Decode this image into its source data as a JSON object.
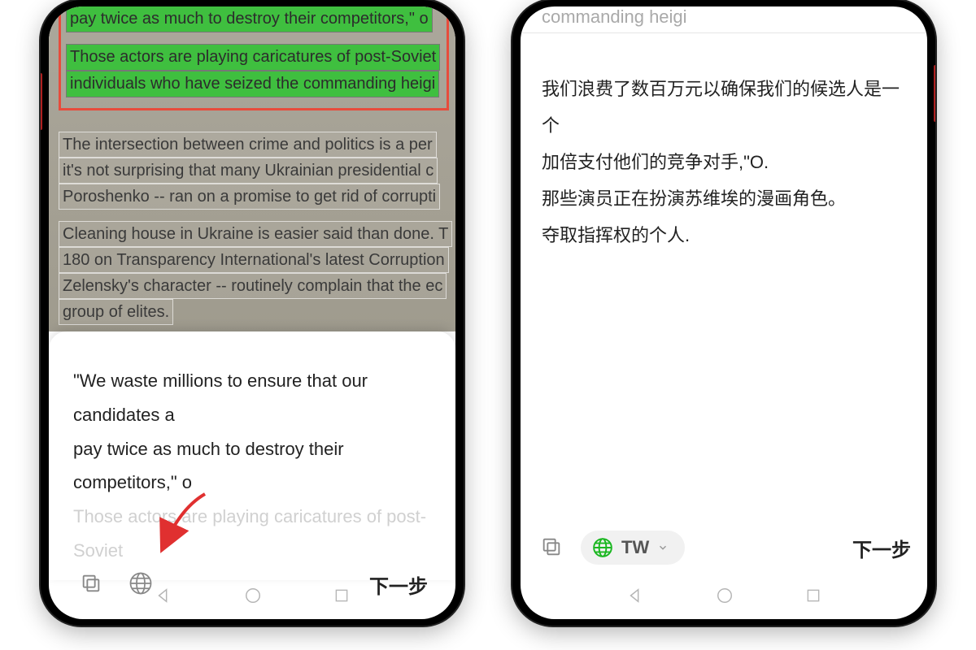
{
  "left": {
    "scan": {
      "highlighted": [
        "pay twice as much to destroy their competitors,\" o",
        "Those actors are playing caricatures of post-Soviet",
        "individuals who have seized the commanding heigi"
      ],
      "para1": [
        "The intersection between crime and politics is a per",
        "it's not surprising that many Ukrainian presidential c",
        "Poroshenko -- ran on a promise to get rid of corrupti"
      ],
      "para2": [
        "Cleaning house in Ukraine is easier said than done. T",
        "180 on Transparency International's latest Corruption",
        "Zelensky's character -- routinely complain that the ec",
        "group of elites."
      ]
    },
    "sheet": {
      "lines": [
        "\"We waste millions to ensure that our candidates a",
        "pay twice as much to destroy their competitors,\" o"
      ],
      "faded": "Those actors are playing caricatures of post-Soviet",
      "next": "下一步"
    }
  },
  "right": {
    "header_hint": "commanding heigi",
    "translation": [
      "我们浪费了数百万元以确保我们的候选人是一个",
      "加倍支付他们的竞争对手,\"O.",
      "那些演员正在扮演苏维埃的漫画角色。",
      "夺取指挥权的个人."
    ],
    "lang_label": "TW",
    "next": "下一步"
  },
  "icons": {
    "copy": "copy-icon",
    "globe": "globe-icon",
    "chevron_down": "chevron-down-icon"
  },
  "colors": {
    "highlight_border": "#e74c3c",
    "highlight_fill": "#3fbf3f",
    "globe_active": "#1bb721"
  }
}
